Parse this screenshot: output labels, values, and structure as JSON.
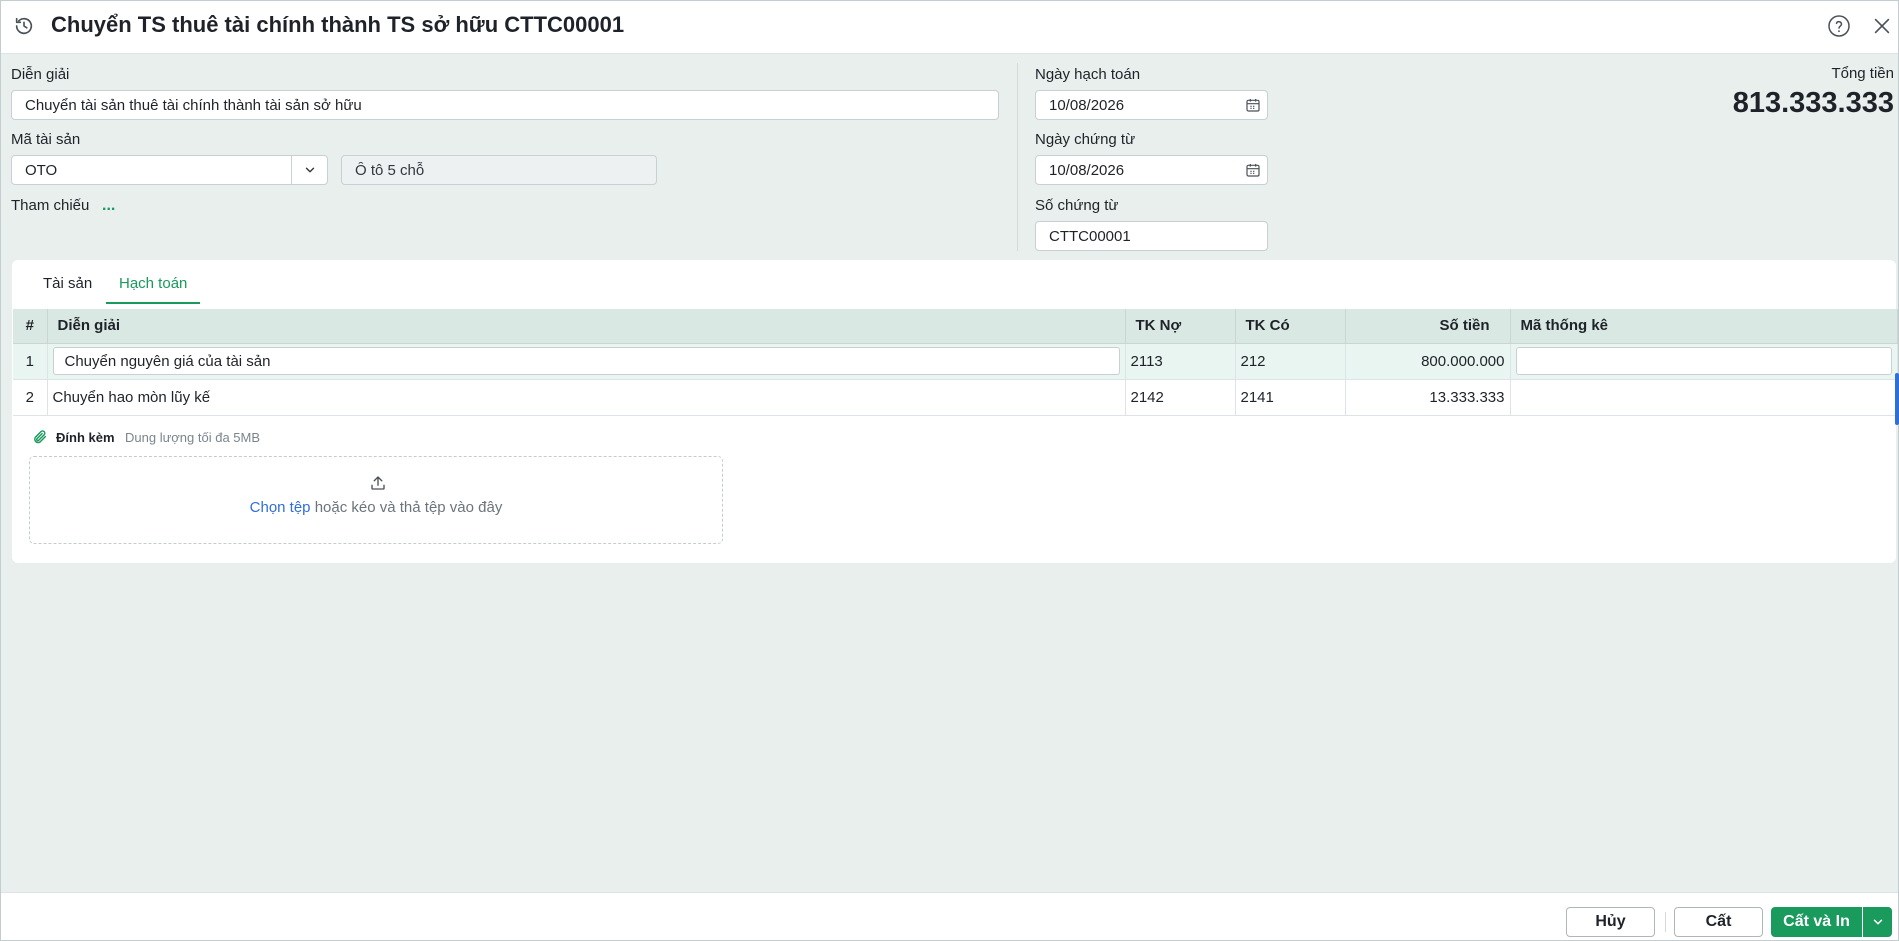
{
  "window": {
    "title": "Chuyển TS thuê tài chính thành TS sở hữu CTTC00001"
  },
  "form": {
    "description_label": "Diễn giải",
    "description_value": "Chuyển tài sản thuê tài chính thành tài sản sở hữu",
    "asset_code_label": "Mã tài sản",
    "asset_code_value": "OTO",
    "asset_name_value": "Ô tô 5 chỗ",
    "reference_label": "Tham chiếu",
    "reference_more": "...",
    "posting_date_label": "Ngày hạch toán",
    "posting_date_value": "10/08/2026",
    "voucher_date_label": "Ngày chứng từ",
    "voucher_date_value": "10/08/2026",
    "voucher_no_label": "Số chứng từ",
    "voucher_no_value": "CTTC00001",
    "total_label": "Tổng tiền",
    "total_value": "813.333.333"
  },
  "tabs": [
    {
      "label": "Tài sản",
      "active": false
    },
    {
      "label": "Hạch toán",
      "active": true
    }
  ],
  "grid": {
    "columns": {
      "index": "#",
      "description": "Diễn giải",
      "debit": "TK Nợ",
      "credit": "TK Có",
      "amount": "Số tiền",
      "stat_code": "Mã thống kê"
    },
    "rows": [
      {
        "index": "1",
        "description": "Chuyển nguyên giá của tài sản",
        "debit": "2113",
        "credit": "212",
        "amount": "800.000.000",
        "stat_code": ""
      },
      {
        "index": "2",
        "description": "Chuyển hao mòn lũy kế",
        "debit": "2142",
        "credit": "2141",
        "amount": "13.333.333",
        "stat_code": ""
      }
    ]
  },
  "attachment": {
    "title": "Đính kèm",
    "note": "Dung lượng tối đa 5MB",
    "choose_link": "Chọn tệp",
    "drop_text": " hoặc kéo và thả tệp vào đây"
  },
  "footer": {
    "cancel_label": "Hủy",
    "save_label": "Cất",
    "save_print_label": "Cất và In"
  },
  "colors": {
    "accent": "#1a9a5c",
    "link": "#2f6fd6",
    "header_row": "#d9e8e3",
    "background": "#e8efed"
  },
  "icons": [
    "history-icon",
    "help-icon",
    "close-icon",
    "chevron-down-icon",
    "calendar-icon",
    "paperclip-icon",
    "upload-icon"
  ]
}
